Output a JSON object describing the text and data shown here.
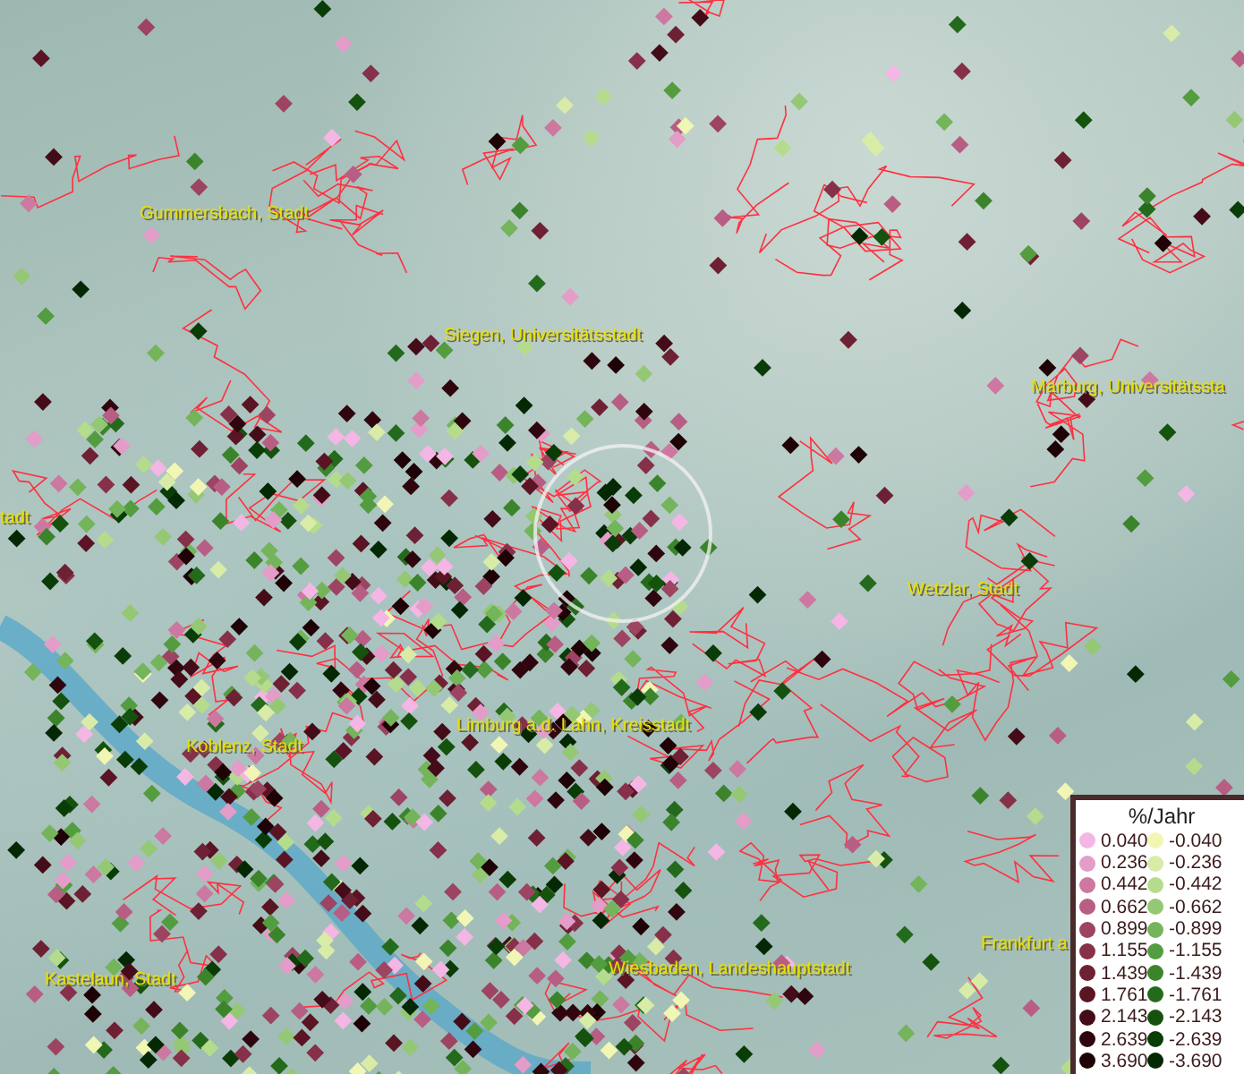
{
  "map": {
    "labels": [
      {
        "text": "Gummersbach, Stadt"
      },
      {
        "text": "Siegen, Universitätsstadt"
      },
      {
        "text": "Marburg, Universitätssta"
      },
      {
        "text": "tadt"
      },
      {
        "text": "Wetzlar, Stadt"
      },
      {
        "text": "Limburg a.d. Lahn, Kreisstadt"
      },
      {
        "text": "Koblenz, Stadt"
      },
      {
        "text": "Kastelaun, Stadt"
      },
      {
        "text": "Wiesbaden, Landeshauptstadt"
      },
      {
        "text": "Frankfurt a"
      }
    ]
  },
  "legend": {
    "title": "%/Jahr",
    "items": [
      {
        "value": "0.040",
        "color": "#f4b6e4"
      },
      {
        "value": "-0.040",
        "color": "#f2f6b4"
      },
      {
        "value": "0.236",
        "color": "#e49cc8"
      },
      {
        "value": "-0.236",
        "color": "#d8eca8"
      },
      {
        "value": "0.442",
        "color": "#cc78a0"
      },
      {
        "value": "-0.442",
        "color": "#b4dc8c"
      },
      {
        "value": "0.662",
        "color": "#b85e84"
      },
      {
        "value": "-0.662",
        "color": "#94c874"
      },
      {
        "value": "0.899",
        "color": "#9c4462"
      },
      {
        "value": "-0.899",
        "color": "#74b45a"
      },
      {
        "value": "1.155",
        "color": "#86304a"
      },
      {
        "value": "-1.155",
        "color": "#549c40"
      },
      {
        "value": "1.439",
        "color": "#6e2034"
      },
      {
        "value": "-1.439",
        "color": "#3c842c"
      },
      {
        "value": "1.761",
        "color": "#5a1424"
      },
      {
        "value": "-1.761",
        "color": "#246a1c"
      },
      {
        "value": "2.143",
        "color": "#440c18"
      },
      {
        "value": "-2.143",
        "color": "#14520e"
      },
      {
        "value": "2.639",
        "color": "#30060e"
      },
      {
        "value": "-2.639",
        "color": "#0a3c08"
      },
      {
        "value": "3.690",
        "color": "#1e0206"
      },
      {
        "value": "-3.690",
        "color": "#042804"
      }
    ]
  }
}
